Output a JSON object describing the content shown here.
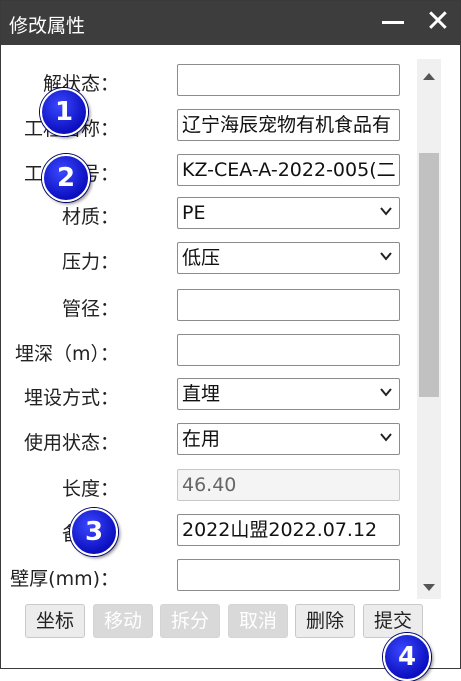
{
  "dialog": {
    "title": "修改属性",
    "minimize_label": "—",
    "close_label": "✕"
  },
  "fields": [
    {
      "label": "解状态：",
      "value": "",
      "type": "text"
    },
    {
      "label": "工程名称：",
      "value": "辽宁海辰宠物有机食品有",
      "type": "text"
    },
    {
      "label": "工程编号：",
      "value": "KZ-CEA-A-2022-005(二",
      "type": "text"
    },
    {
      "label": "材质：",
      "value": "PE",
      "type": "select"
    },
    {
      "label": "压力：",
      "value": "低压",
      "type": "select"
    },
    {
      "label": "管径：",
      "value": "",
      "type": "text"
    },
    {
      "label": "埋深（m）：",
      "value": "",
      "type": "text"
    },
    {
      "label": "埋设方式：",
      "value": "直埋",
      "type": "select"
    },
    {
      "label": "使用状态：",
      "value": "在用",
      "type": "select"
    },
    {
      "label": "长度：",
      "value": "46.40",
      "type": "readonly"
    },
    {
      "label": "备注：",
      "value": "2022山盟2022.07.12",
      "type": "text"
    },
    {
      "label": "壁厚(mm)：",
      "value": "",
      "type": "text"
    }
  ],
  "buttons": [
    {
      "label": "坐标",
      "enabled": true
    },
    {
      "label": "移动",
      "enabled": false
    },
    {
      "label": "拆分",
      "enabled": false
    },
    {
      "label": "取消",
      "enabled": false
    },
    {
      "label": "删除",
      "enabled": true
    },
    {
      "label": "提交",
      "enabled": true
    }
  ],
  "badges": [
    "1",
    "2",
    "3",
    "4"
  ],
  "icons": {
    "dropdown": "chevron-down-icon",
    "scroll_up": "scroll-up-arrow-icon",
    "scroll_down": "scroll-down-arrow-icon",
    "minimize": "minimize-icon",
    "close": "close-icon"
  },
  "colors": {
    "titlebar": "#3d3d3d",
    "badge": "#1a23e0",
    "disabled_button": "#d9d9d9"
  }
}
